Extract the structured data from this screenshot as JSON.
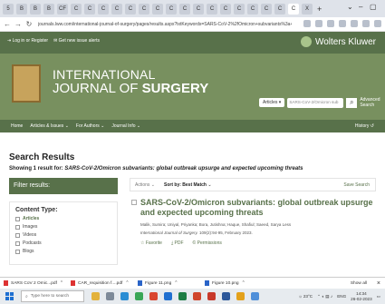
{
  "browser": {
    "tabs": [
      "5",
      "B",
      "B",
      "B",
      "CF",
      "C",
      "C",
      "C",
      "C",
      "C",
      "C",
      "C",
      "C",
      "C",
      "C",
      "C",
      "C",
      "C",
      "C",
      "C",
      "C",
      "C",
      "X"
    ],
    "new_tab": "+",
    "url": "journals.lww.com/international-journal-of-surgery/pages/results.aspx?txtKeywords=SARS-CoV-2%2fOmicron+subvariants%3a+global+out..."
  },
  "site": {
    "login": "Log in or Register",
    "alerts": "Get new issue alerts",
    "brand": "Wolters Kluwer",
    "journal_line1": "INTERNATIONAL",
    "journal_line2a": "JOURNAL OF ",
    "journal_line2b": "SURGERY",
    "scope_label": "Articles",
    "search_value": "SARS-CoV-2/Omicron sub",
    "advanced_line1": "Advanced",
    "advanced_line2": "Search",
    "nav": [
      "Home",
      "Articles & Issues",
      "For Authors",
      "Journal Info"
    ],
    "history": "History"
  },
  "results": {
    "heading": "Search Results",
    "showing_prefix": "Showing 1 result for: ",
    "query": "SARS-CoV-2/Omicron subvariants: global outbreak upsurge and expected upcoming threats",
    "filter_heading": "Filter results:",
    "content_type": {
      "heading": "Content Type:",
      "items": [
        "Articles",
        "Images",
        "Videos",
        "Podcasts",
        "Blogs"
      ]
    },
    "actions_label": "Actions",
    "sort_label": "Sort by: Best Match",
    "save_search": "Save Search",
    "article": {
      "title": "SARS-CoV-2/Omicron subvariants: global outbreak upsurge and expected upcoming threats",
      "authors": "Malik, Sumira; Uniyal, Priyanka; Bora, Jutishna; Haque, Shafiul; Saeed, Sarya Less",
      "journal": "International Journal of Surgery.",
      "citation": " 109(2):94-95, February 2023.",
      "favorite": "Favorite",
      "pdf": "PDF",
      "permissions": "Permissions"
    }
  },
  "downloads": {
    "items": [
      "SARS CoV 2 Omic...pdf",
      "CAR_requisition f....pdf",
      "Figure 11.png",
      "Figure 10.png"
    ],
    "show_all": "Show all"
  },
  "taskbar": {
    "search_placeholder": "Type here to search",
    "weather": "23°C",
    "time": "14:34",
    "date": "26-02-2023",
    "lang": "ENG"
  }
}
